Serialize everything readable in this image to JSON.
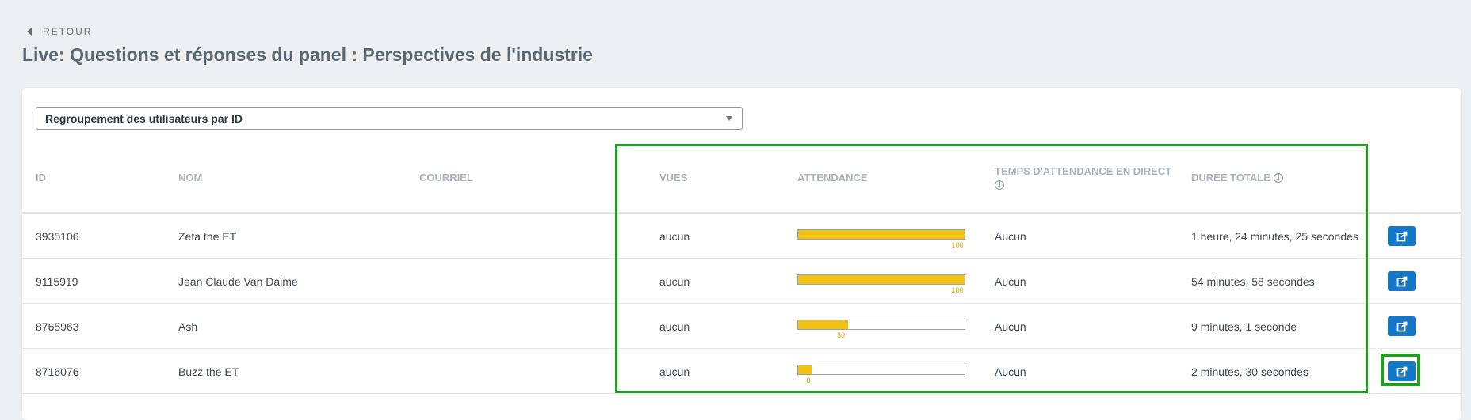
{
  "nav": {
    "back_label": "RETOUR"
  },
  "page": {
    "title": "Live: Questions et réponses du panel : Perspectives de l'industrie"
  },
  "grouping_select": {
    "value": "Regroupement des utilisateurs par ID"
  },
  "columns": {
    "id": "ID",
    "name": "NOM",
    "email": "COURRIEL",
    "views": "VUES",
    "attendance": "ATTENDANCE",
    "live_time": "TEMPS D'ATTENDANCE EN DIRECT",
    "total": "DURÉE TOTALE"
  },
  "rows": [
    {
      "id": "3935106",
      "name": "Zeta the ET",
      "email": "",
      "views": "aucun",
      "attendance": 100,
      "attendance_label": "100",
      "live_time": "Aucun",
      "total": "1 heure, 24 minutes, 25 secondes"
    },
    {
      "id": "9115919",
      "name": "Jean Claude Van Daime",
      "email": "",
      "views": "aucun",
      "attendance": 100,
      "attendance_label": "100",
      "live_time": "Aucun",
      "total": "54 minutes, 58 secondes"
    },
    {
      "id": "8765963",
      "name": "Ash",
      "email": "",
      "views": "aucun",
      "attendance": 30,
      "attendance_label": "30",
      "live_time": "Aucun",
      "total": "9 minutes, 1 seconde"
    },
    {
      "id": "8716076",
      "name": "Buzz the ET",
      "email": "",
      "views": "aucun",
      "attendance": 8,
      "attendance_label": "8",
      "live_time": "Aucun",
      "total": "2 minutes, 30 secondes"
    }
  ],
  "colors": {
    "bar_fill": "#f2c111",
    "button": "#1377c9",
    "highlight": "#1fa01f"
  },
  "icons": {
    "back": "caret-left-icon",
    "select": "chevron-down-icon",
    "info": "info-icon",
    "open": "external-link-icon"
  }
}
